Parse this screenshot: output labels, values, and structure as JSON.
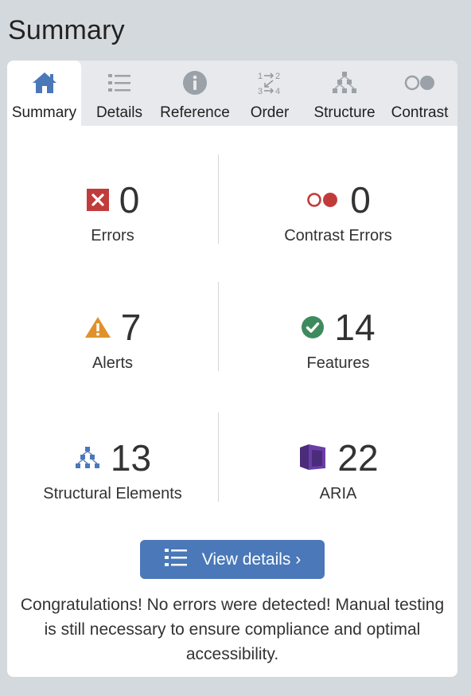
{
  "page": {
    "title": "Summary"
  },
  "tabs": [
    {
      "label": "Summary",
      "icon": "home-icon",
      "active": true
    },
    {
      "label": "Details",
      "icon": "list-icon",
      "active": false
    },
    {
      "label": "Reference",
      "icon": "info-icon",
      "active": false
    },
    {
      "label": "Order",
      "icon": "order-icon",
      "active": false
    },
    {
      "label": "Structure",
      "icon": "structure-icon",
      "active": false
    },
    {
      "label": "Contrast",
      "icon": "contrast-icon",
      "active": false
    }
  ],
  "stats": {
    "errors": {
      "count": "0",
      "label": "Errors",
      "icon": "error-icon",
      "color": "#c23b3b"
    },
    "contrast_errors": {
      "count": "0",
      "label": "Contrast Errors",
      "icon": "contrast-error-icon",
      "color": "#c23b3b"
    },
    "alerts": {
      "count": "7",
      "label": "Alerts",
      "icon": "alert-icon",
      "color": "#e0912b"
    },
    "features": {
      "count": "14",
      "label": "Features",
      "icon": "check-icon",
      "color": "#3d8a5e"
    },
    "structural": {
      "count": "13",
      "label": "Structural Elements",
      "icon": "structure-icon",
      "color": "#4a78b8"
    },
    "aria": {
      "count": "22",
      "label": "ARIA",
      "icon": "aria-icon",
      "color": "#4b2c7a"
    }
  },
  "view_details_button": {
    "label": "View details ›",
    "icon": "list-icon",
    "color": "#4a78b8"
  },
  "message": "Congratulations! No errors were detected! Manual testing is still necessary to ensure compliance and optimal accessibility."
}
